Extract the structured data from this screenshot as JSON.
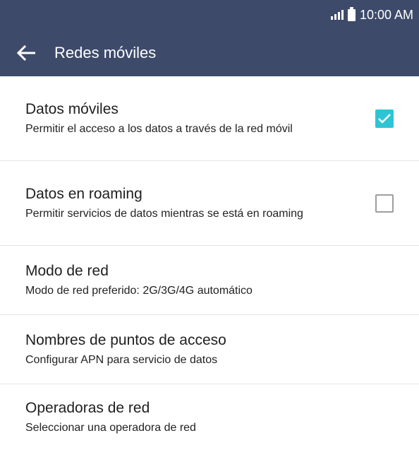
{
  "status_bar": {
    "time": "10:00 AM",
    "signal_icon": "signal-bars-icon",
    "battery_icon": "battery-icon"
  },
  "app_bar": {
    "title": "Redes móviles",
    "back_icon": "arrow-left-icon"
  },
  "settings": [
    {
      "title": "Datos móviles",
      "subtitle": "Permitir el acceso a los datos a través de la red móvil",
      "checkbox": true,
      "checked": true
    },
    {
      "title": "Datos en roaming",
      "subtitle": "Permitir servicios de datos mientras se está en roaming",
      "checkbox": true,
      "checked": false
    },
    {
      "title": "Modo de red",
      "subtitle": "Modo de red preferido: 2G/3G/4G automático",
      "checkbox": false
    },
    {
      "title": "Nombres de puntos de acceso",
      "subtitle": "Configurar APN para servicio de datos",
      "checkbox": false
    },
    {
      "title": "Operadoras de red",
      "subtitle": "Seleccionar una operadora de red",
      "checkbox": false
    }
  ],
  "colors": {
    "header": "#3d4a6a",
    "accent": "#2ec4d6"
  }
}
